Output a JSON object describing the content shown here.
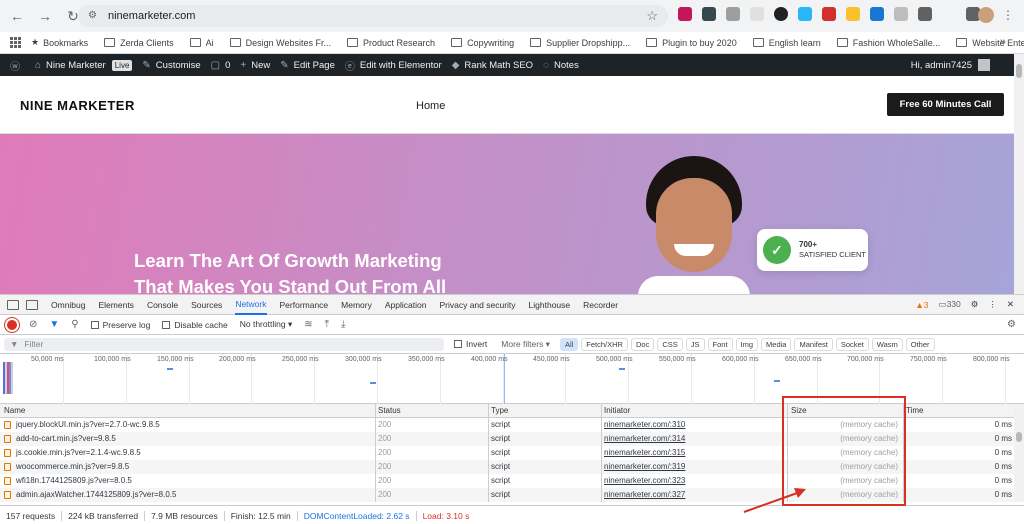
{
  "browser": {
    "url": "ninemarketer.com",
    "bookmarks": [
      "Bookmarks",
      "Zerda Clients",
      "Ai",
      "Design Websites Fr...",
      "Product Research",
      "Copywriting",
      "Supplier Dropshipp...",
      "Plugin to buy 2020",
      "English learn",
      "Fashion WholeSalle...",
      "Website Enterpren..."
    ]
  },
  "wpbar": {
    "site_name": "Nine Marketer",
    "live": "Live",
    "customise": "Customise",
    "comments": "0",
    "new": "New",
    "edit_page": "Edit Page",
    "elementor": "Edit with Elementor",
    "rankmath": "Rank Math SEO",
    "notes": "Notes",
    "greeting": "Hi, admin7425"
  },
  "site": {
    "logo": "NINE MARKETER",
    "nav_home": "Home",
    "cta": "Free 60 Minutes Call",
    "hero_line1": "Learn The Art Of Growth Marketing",
    "hero_line2": "That Makes You Stand Out From All",
    "badge_count": "700+",
    "badge_label": "SATISFIED CLIENT"
  },
  "devtools": {
    "tabs": [
      "Omnibug",
      "Elements",
      "Console",
      "Sources",
      "Network",
      "Performance",
      "Memory",
      "Application",
      "Privacy and security",
      "Lighthouse",
      "Recorder"
    ],
    "active_tab": "Network",
    "warnings": "3",
    "issues": "330",
    "preserve_log": "Preserve log",
    "disable_cache": "Disable cache",
    "throttling": "No throttling",
    "filter_placeholder": "Filter",
    "invert": "Invert",
    "more_filters": "More filters",
    "type_filters": [
      "All",
      "Fetch/XHR",
      "Doc",
      "CSS",
      "JS",
      "Font",
      "Img",
      "Media",
      "Manifest",
      "Socket",
      "Wasm",
      "Other"
    ],
    "timeline_ticks": [
      "50,000 ms",
      "100,000 ms",
      "150,000 ms",
      "200,000 ms",
      "250,000 ms",
      "300,000 ms",
      "350,000 ms",
      "400,000 ms",
      "450,000 ms",
      "500,000 ms",
      "550,000 ms",
      "600,000 ms",
      "650,000 ms",
      "700,000 ms",
      "750,000 ms",
      "800,000 ms"
    ],
    "columns": {
      "name": "Name",
      "status": "Status",
      "type": "Type",
      "initiator": "Initiator",
      "size": "Size",
      "time": "Time"
    },
    "rows": [
      {
        "name": "jquery.blockUI.min.js?ver=2.7.0-wc.9.8.5",
        "status": "200",
        "type": "script",
        "initiator": "ninemarketer.com/:310",
        "size": "(memory cache)",
        "time": "0 ms"
      },
      {
        "name": "add-to-cart.min.js?ver=9.8.5",
        "status": "200",
        "type": "script",
        "initiator": "ninemarketer.com/:314",
        "size": "(memory cache)",
        "time": "0 ms"
      },
      {
        "name": "js.cookie.min.js?ver=2.1.4-wc.9.8.5",
        "status": "200",
        "type": "script",
        "initiator": "ninemarketer.com/:315",
        "size": "(memory cache)",
        "time": "0 ms"
      },
      {
        "name": "woocommerce.min.js?ver=9.8.5",
        "status": "200",
        "type": "script",
        "initiator": "ninemarketer.com/:319",
        "size": "(memory cache)",
        "time": "0 ms"
      },
      {
        "name": "wfi18n.1744125809.js?ver=8.0.5",
        "status": "200",
        "type": "script",
        "initiator": "ninemarketer.com/:323",
        "size": "(memory cache)",
        "time": "0 ms"
      },
      {
        "name": "admin.ajaxWatcher.1744125809.js?ver=8.0.5",
        "status": "200",
        "type": "script",
        "initiator": "ninemarketer.com/:327",
        "size": "(memory cache)",
        "time": "0 ms"
      }
    ],
    "status_bar": {
      "requests": "157 requests",
      "transferred": "224 kB transferred",
      "resources": "7.9 MB resources",
      "finish": "Finish: 12.5 min",
      "dcl": "DOMContentLoaded: 2.62 s",
      "load": "Load: 3.10 s"
    }
  },
  "colors": {
    "accent": "#1a73e8",
    "annotation": "#d93025",
    "wp_bar": "#1d2327"
  }
}
